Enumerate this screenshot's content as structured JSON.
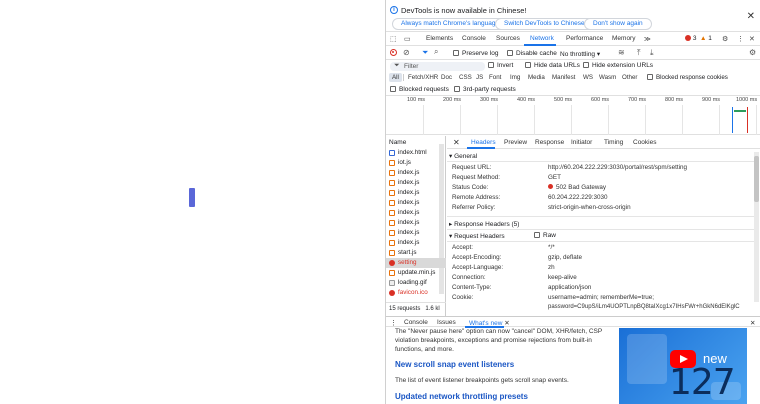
{
  "infobar": {
    "message": "DevTools is now available in Chinese!",
    "btn_match": "Always match Chrome's language",
    "btn_switch": "Switch DevTools to Chinese",
    "btn_dont_show": "Don't show again",
    "close": "✕"
  },
  "tabs": {
    "elements": "Elements",
    "console": "Console",
    "sources": "Sources",
    "network": "Network",
    "performance": "Performance",
    "memory": "Memory",
    "more": "≫",
    "errors": "3",
    "warnings": "1"
  },
  "toolbar": {
    "preserve_log": "Preserve log",
    "disable_cache": "Disable cache",
    "throttling": "No throttling",
    "filter_placeholder": "Filter",
    "invert": "Invert",
    "hide_data_urls": "Hide data URLs",
    "hide_extension_urls": "Hide extension URLs",
    "types": [
      "All",
      "Fetch/XHR",
      "Doc",
      "CSS",
      "JS",
      "Font",
      "Img",
      "Media",
      "Manifest",
      "WS",
      "Wasm",
      "Other"
    ],
    "blocked_cookies": "Blocked response cookies",
    "blocked_requests": "Blocked requests",
    "third_party": "3rd-party requests"
  },
  "timeline": {
    "ticks": [
      "100 ms",
      "200 ms",
      "300 ms",
      "400 ms",
      "500 ms",
      "600 ms",
      "700 ms",
      "800 ms",
      "900 ms",
      "1000 ms"
    ]
  },
  "network_list": {
    "column_name": "Name",
    "rows": [
      {
        "name": "index.html",
        "kind": "doc"
      },
      {
        "name": "iot.js",
        "kind": "js"
      },
      {
        "name": "index.js",
        "kind": "js"
      },
      {
        "name": "index.js",
        "kind": "js"
      },
      {
        "name": "index.js",
        "kind": "js"
      },
      {
        "name": "index.js",
        "kind": "js"
      },
      {
        "name": "index.js",
        "kind": "js"
      },
      {
        "name": "index.js",
        "kind": "js"
      },
      {
        "name": "index.js",
        "kind": "js"
      },
      {
        "name": "index.js",
        "kind": "js"
      },
      {
        "name": "start.js",
        "kind": "js"
      },
      {
        "name": "setting",
        "kind": "err"
      },
      {
        "name": "update.min.js",
        "kind": "js"
      },
      {
        "name": "loading.gif",
        "kind": "img"
      },
      {
        "name": "favicon.ico",
        "kind": "err"
      }
    ],
    "status_requests": "15 requests",
    "status_size": "1.6 kl"
  },
  "details": {
    "close": "✕",
    "tabs": [
      "Headers",
      "Preview",
      "Response",
      "Initiator",
      "Timing",
      "Cookies"
    ],
    "general_title": "▾ General",
    "general": [
      {
        "k": "Request URL:",
        "v": "http://60.204.222.229:3030/portal/rest/spm/setting"
      },
      {
        "k": "Request Method:",
        "v": "GET"
      },
      {
        "k": "Status Code:",
        "v": "502 Bad Gateway"
      },
      {
        "k": "Remote Address:",
        "v": "60.204.222.229:3030"
      },
      {
        "k": "Referrer Policy:",
        "v": "strict-origin-when-cross-origin"
      }
    ],
    "response_headers_title": "▸ Response Headers (5)",
    "request_headers_title": "▾ Request Headers",
    "raw_label": "Raw",
    "request_headers": [
      {
        "k": "Accept:",
        "v": "*/*"
      },
      {
        "k": "Accept-Encoding:",
        "v": "gzip, deflate"
      },
      {
        "k": "Accept-Language:",
        "v": "zh"
      },
      {
        "k": "Connection:",
        "v": "keep-alive"
      },
      {
        "k": "Content-Type:",
        "v": "application/json"
      },
      {
        "k": "Cookie:",
        "v": "username=admin; rememberMe=true;"
      },
      {
        "k": "",
        "v": "password=C9upS/iLm4UOPTLnpBQ8taIXcg1x7IHsFWr+hGkN6dElKglC"
      }
    ]
  },
  "drawer": {
    "console": "Console",
    "issues": "Issues",
    "whats_new": "What's new",
    "close": "✕"
  },
  "whats_new": {
    "para1": "The \"Never pause here\" option can now \"cancel\" DOM, XHR/fetch, CSP violation breakpoints, exceptions and promise rejections from built-in functions, and more.",
    "h1": "New scroll snap event listeners",
    "para2": "The list of event listener breakpoints gets scroll snap events.",
    "h2": "Updated network throttling presets",
    "promo_new": "new",
    "promo_num": "127"
  },
  "colors": {
    "accent": "#1a73e8",
    "error": "#d93025",
    "page_marker": "#5a67d8"
  }
}
